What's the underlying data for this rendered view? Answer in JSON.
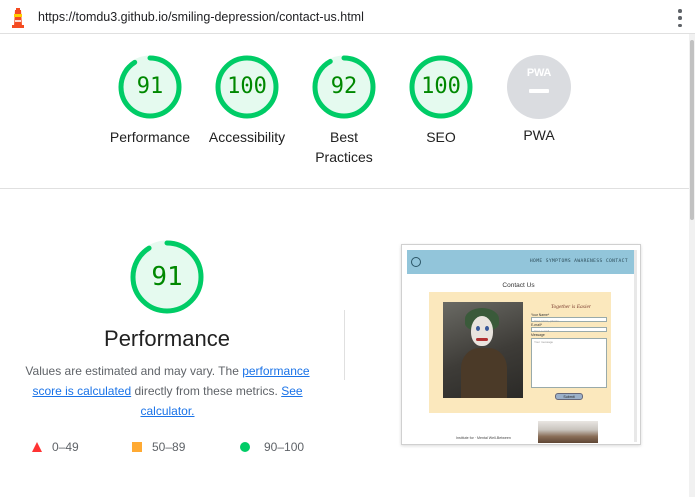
{
  "browser": {
    "url": "https://tomdu3.github.io/smiling-depression/contact-us.html",
    "logo_icon": "lighthouse-icon",
    "menu_icon": "kebab-menu-icon"
  },
  "summary": {
    "categories": [
      {
        "label": "Performance",
        "score": "91",
        "fraction": 0.91
      },
      {
        "label": "Accessibility",
        "score": "100",
        "fraction": 1.0
      },
      {
        "label": "Best Practices",
        "score": "92",
        "fraction": 0.92
      },
      {
        "label": "SEO",
        "score": "100",
        "fraction": 1.0
      }
    ],
    "pwa": {
      "badge_text": "PWA",
      "label": "PWA"
    }
  },
  "performance": {
    "score": "91",
    "fraction": 0.91,
    "title": "Performance",
    "desc_prefix": "Values are estimated and may vary. The ",
    "desc_link1": "performance score is calculated",
    "desc_middle": " directly from these metrics. ",
    "desc_link2": "See calculator."
  },
  "legend": {
    "fail": "0–49",
    "average": "50–89",
    "pass": "90–100"
  },
  "thumbnail": {
    "nav_items": "HOME  SYMPTOMS  AWARENESS  CONTACT",
    "heading": "Contact Us",
    "form_title": "Together is Easier",
    "label_name": "Your Name*",
    "placeholder_name": "Your name, please",
    "label_email": "E-mail*",
    "placeholder_email": "Your e-mail",
    "label_message": "Message",
    "placeholder_message": "Your message",
    "button": "Submit",
    "footer": "Institute for · Mental Well-Between"
  },
  "colors": {
    "pass": "#00cc66",
    "pass_fill": "#e5faef",
    "pass_text": "#008800",
    "average": "#ffaa33",
    "fail": "#ff3333",
    "pwa_gray": "#dadce0",
    "link": "#1a73e8"
  }
}
